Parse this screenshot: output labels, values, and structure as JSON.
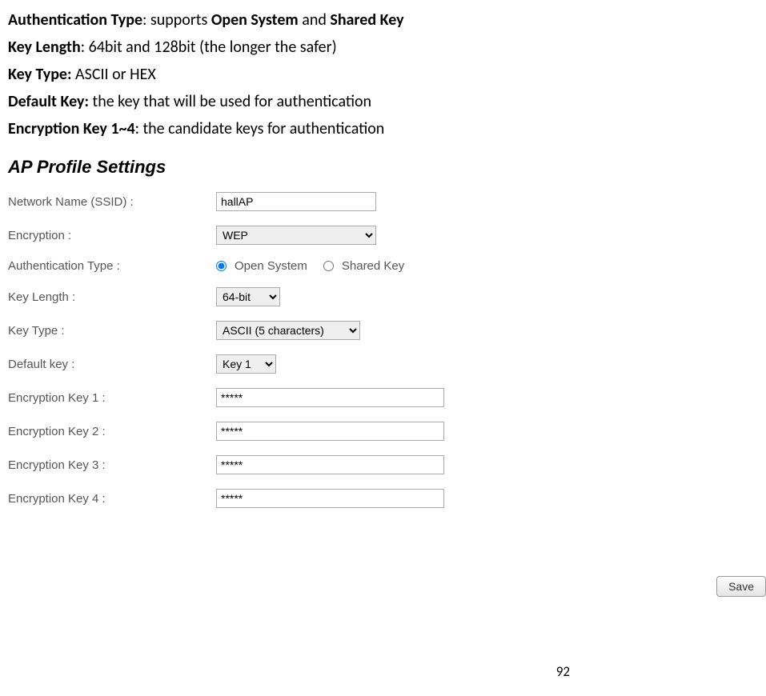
{
  "doc": {
    "line1_label": "Authentication Type",
    "line1_sep": ": supports ",
    "line1_b1": "Open System",
    "line1_mid": " and ",
    "line1_b2": "Shared Key",
    "line2_label": "Key Length",
    "line2_rest": ": 64bit and 128bit (the longer the safer)",
    "line3_label": "Key Type:",
    "line3_rest": " ASCII or HEX",
    "line4_label": "Default Key:",
    "line4_rest": " the key that will be used for authentication",
    "line5_label": "Encryption Key 1~4",
    "line5_rest": ": the candidate keys for authentication"
  },
  "panel": {
    "title": "AP Profile Settings",
    "ssid_label": "Network Name (SSID) :",
    "ssid_value": "hallAP",
    "encryption_label": "Encryption :",
    "encryption_value": "WEP",
    "auth_type_label": "Authentication Type :",
    "auth_open": "Open System",
    "auth_shared": "Shared Key",
    "key_length_label": "Key Length :",
    "key_length_value": "64-bit",
    "key_type_label": "Key Type :",
    "key_type_value": "ASCII (5 characters)",
    "default_key_label": "Default key :",
    "default_key_value": "Key 1",
    "enc_key1_label": "Encryption Key 1 :",
    "enc_key1_value": "*****",
    "enc_key2_label": "Encryption Key 2 :",
    "enc_key2_value": "*****",
    "enc_key3_label": "Encryption Key 3 :",
    "enc_key3_value": "*****",
    "enc_key4_label": "Encryption Key 4 :",
    "enc_key4_value": "*****",
    "save_label": "Save"
  },
  "page_number": "92"
}
